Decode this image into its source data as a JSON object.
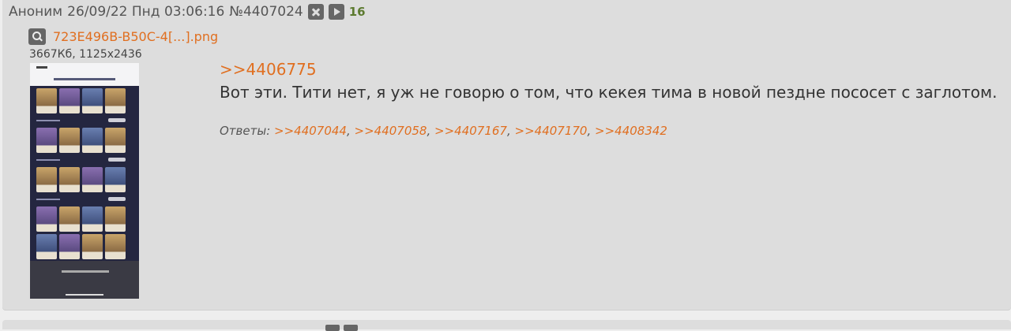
{
  "post": {
    "author": "Аноним",
    "date": "26/09/22 Пнд 03:06:16",
    "number": "№4407024",
    "reply_count": "16",
    "file": {
      "name": "723E496B-B50C-4[...].png",
      "meta": "3667Кб, 1125x2436"
    },
    "quote": ">>4406775",
    "message": "Вот эти. Тити нет, я уж не говорю о том, что кекея тима в новой пездне пососет с заглотом.",
    "answers_label": "Ответы:",
    "answers": [
      ">>4407044",
      ">>4407058",
      ">>4407167",
      ">>4407170",
      ">>4408342"
    ],
    "separator": ","
  },
  "icons": {
    "hide": "close-icon",
    "play": "play-icon",
    "zoom": "magnifier-icon"
  },
  "colors": {
    "link": "#e06f20",
    "reply_count": "#5c7a2f",
    "post_bg": "#dddddd",
    "page_bg": "#eeeeee"
  }
}
